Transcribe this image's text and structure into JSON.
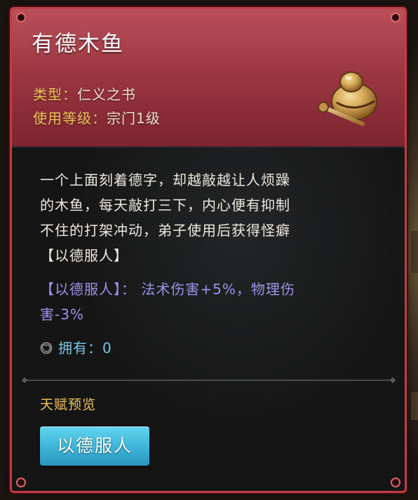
{
  "item": {
    "name": "有德木鱼",
    "type_label": "类型：",
    "type_value": "仁义之书",
    "level_label": "使用等级：",
    "level_value": "宗门1级",
    "icon": "wooden-fish-icon"
  },
  "description": {
    "lines": [
      "一个上面刻着德字，却越敲越让人烦躁",
      "的木鱼，每天敲打三下，内心便有抑制",
      "不住的打架冲动，弟子使用后获得怪癖",
      "【以德服人】"
    ]
  },
  "effect": {
    "lines": [
      "【以德服人】：  法术伤害+5%，物理伤",
      "害-3%"
    ]
  },
  "ownership": {
    "label": "拥有：",
    "value": "0",
    "icon": "swirl-icon"
  },
  "talent": {
    "section_label": "天赋预览",
    "button_label": "以德服人"
  },
  "colors": {
    "frame": "#c23c44",
    "header": "#9c3742",
    "gold": "#f0c55a",
    "effect_purple": "#9d93ee",
    "own_blue": "#74c6e6",
    "button_cyan": "#3fb7da"
  }
}
